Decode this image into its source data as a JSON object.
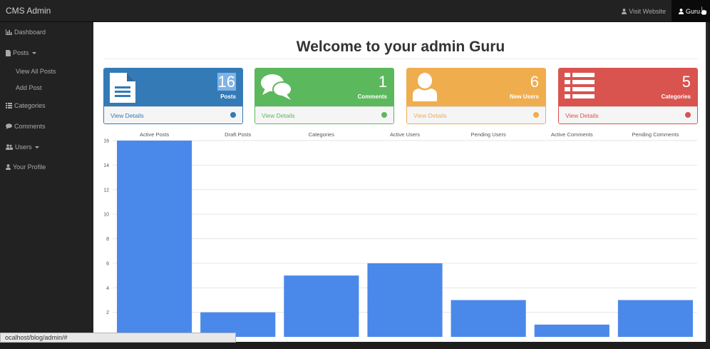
{
  "navbar": {
    "brand": "CMS Admin",
    "visit_website": "Visit Website",
    "user": "Guru"
  },
  "sidebar": {
    "items": [
      {
        "label": "Dashboard",
        "icon": "bar-chart-icon"
      },
      {
        "label": "Posts",
        "icon": "file-icon",
        "dropdown": true
      },
      {
        "label": "Categories",
        "icon": "list-icon"
      },
      {
        "label": "Comments",
        "icon": "comment-icon"
      },
      {
        "label": "Users",
        "icon": "users-icon",
        "dropdown": true
      },
      {
        "label": "Your Profile",
        "icon": "user-icon"
      }
    ],
    "posts_sub": [
      "View All Posts",
      "Add Post"
    ]
  },
  "main": {
    "title": "Welcome to your admin Guru",
    "panels": [
      {
        "count": "16",
        "label": "Posts",
        "link": "View Details",
        "color": "#337ab7",
        "icon": "file-text-icon"
      },
      {
        "count": "1",
        "label": "Comments",
        "link": "View Details",
        "color": "#5cb85c",
        "icon": "comments-icon"
      },
      {
        "count": "6",
        "label": "New Users",
        "link": "View Details",
        "color": "#f0ad4e",
        "icon": "user-icon"
      },
      {
        "count": "5",
        "label": "Categories",
        "link": "View Details",
        "color": "#d9534f",
        "icon": "list-icon"
      }
    ]
  },
  "chart_data": {
    "type": "bar",
    "categories": [
      "Active Posts",
      "Draft Posts",
      "Categories",
      "Active Users",
      "Pending Users",
      "Active Comments",
      "Pending Comments"
    ],
    "values": [
      16,
      2,
      5,
      6,
      3,
      1,
      3
    ],
    "ylim": [
      0,
      16
    ],
    "yticks": [
      2,
      4,
      6,
      8,
      10,
      12,
      14,
      16
    ],
    "grid": true,
    "legend": "none",
    "bar_color": "#4a89ea"
  },
  "statusbar": {
    "url": "ocalhost/blog/admin/#"
  }
}
